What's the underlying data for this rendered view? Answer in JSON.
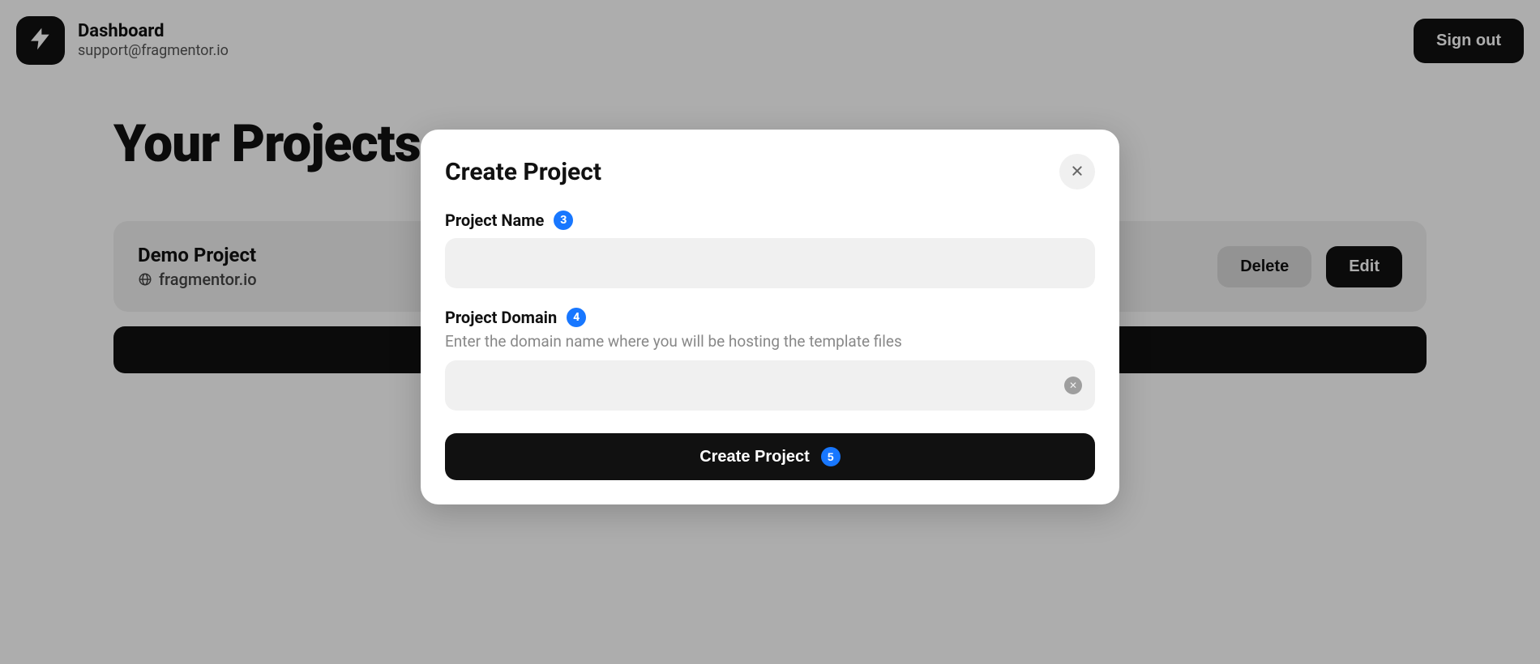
{
  "header": {
    "title": "Dashboard",
    "subtitle": "support@fragmentor.io",
    "signout_label": "Sign out"
  },
  "page": {
    "title": "Your Projects"
  },
  "projects": [
    {
      "name": "Demo Project",
      "domain": "fragmentor.io",
      "actions": {
        "delete": "Delete",
        "edit": "Edit"
      }
    }
  ],
  "modal": {
    "title": "Create Project",
    "fields": {
      "name": {
        "label": "Project Name",
        "badge": "3",
        "value": ""
      },
      "domain": {
        "label": "Project Domain",
        "badge": "4",
        "helper": "Enter the domain name where you will be hosting the template files",
        "value": ""
      }
    },
    "submit": {
      "label": "Create Project",
      "badge": "5"
    }
  }
}
